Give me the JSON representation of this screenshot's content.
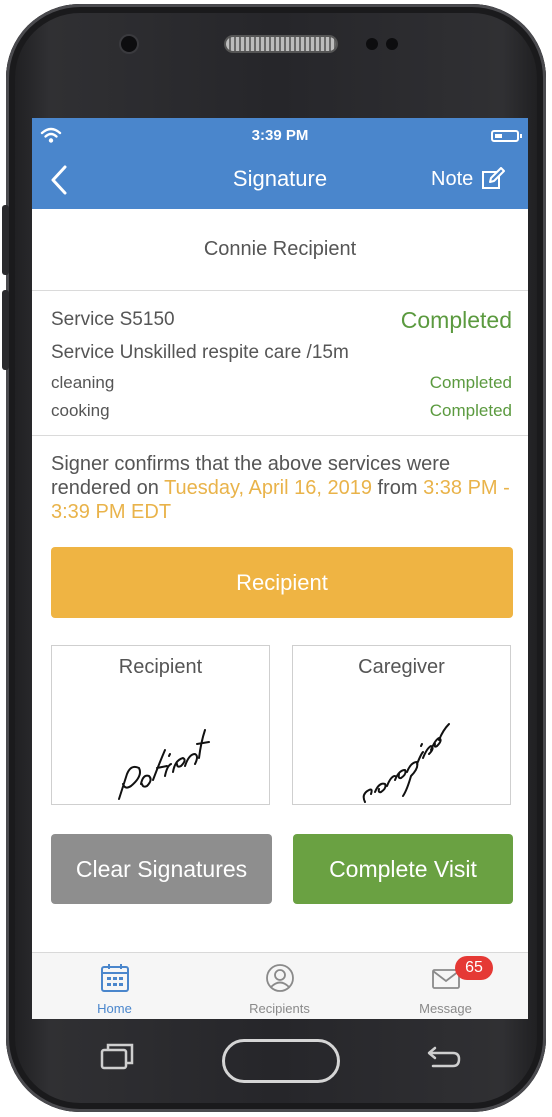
{
  "status_bar": {
    "time": "3:39 PM"
  },
  "nav": {
    "title": "Signature",
    "note_label": "Note"
  },
  "recipient_name": "Connie Recipient",
  "services": {
    "code_line": "Service S5150",
    "code_status": "Completed",
    "description": "Service Unskilled respite care /15m",
    "tasks": [
      {
        "name": "cleaning",
        "status": "Completed"
      },
      {
        "name": "cooking",
        "status": "Completed"
      }
    ]
  },
  "confirmation": {
    "prefix": "Signer confirms that the above services were rendered on ",
    "date": "Tuesday, April 16, 2019",
    "middle": " from ",
    "time_range": "3:38 PM - 3:39 PM EDT"
  },
  "signer_button": "Recipient",
  "signatures": [
    {
      "label": "Recipient",
      "signature_text": "patient"
    },
    {
      "label": "Caregiver",
      "signature_text": "caregiver"
    }
  ],
  "actions": {
    "clear": "Clear Signatures",
    "complete": "Complete Visit"
  },
  "tabs": [
    {
      "label": "Home",
      "icon": "calendar-icon",
      "active": true
    },
    {
      "label": "Recipients",
      "icon": "person-icon",
      "active": false
    },
    {
      "label": "Message",
      "icon": "envelope-icon",
      "active": false,
      "badge": "65"
    }
  ],
  "colors": {
    "header": "#4a86cc",
    "completed_green": "#5b9a3f",
    "highlight_orange": "#e9b34a",
    "signer_button": "#efb443",
    "complete_button": "#6aa142",
    "clear_button": "#8e8e8e",
    "badge": "#e53935"
  }
}
